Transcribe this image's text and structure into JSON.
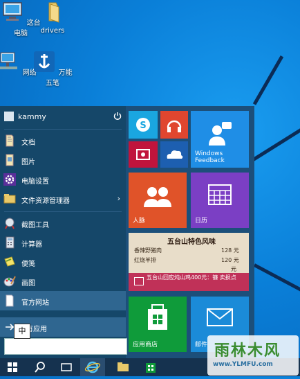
{
  "desktop": {
    "icons": [
      {
        "label": "这台电脑",
        "icon": "computer-icon"
      },
      {
        "label": "drivers",
        "icon": "folder-icon"
      },
      {
        "label": "网络",
        "icon": "network-icon"
      },
      {
        "label": "万能五笔",
        "icon": "ime-app-icon"
      }
    ]
  },
  "start_menu": {
    "user": {
      "name": "kammy"
    },
    "items": [
      {
        "label": "文档",
        "icon": "documents-icon"
      },
      {
        "label": "图片",
        "icon": "pictures-icon"
      },
      {
        "label": "电脑设置",
        "icon": "settings-gear-icon"
      },
      {
        "label": "文件资源管理器",
        "icon": "file-explorer-icon",
        "has_submenu": true
      },
      {
        "label": "截图工具",
        "icon": "snipping-tool-icon"
      },
      {
        "label": "计算器",
        "icon": "calculator-icon"
      },
      {
        "label": "便笺",
        "icon": "sticky-notes-icon"
      },
      {
        "label": "画图",
        "icon": "paint-icon"
      },
      {
        "label": "官方网站",
        "icon": "webpage-icon"
      }
    ],
    "all_apps_label": "有应用",
    "search": {
      "ime_indicator": "中",
      "value": ""
    },
    "tiles": {
      "skype": {
        "label": ""
      },
      "music": {
        "label": ""
      },
      "video": {
        "label": ""
      },
      "onedrive": {
        "label": ""
      },
      "feedback": {
        "label": "Windows Feedback"
      },
      "people": {
        "label": "人脉"
      },
      "calendar": {
        "label": "日历"
      },
      "news": {
        "menu_title": "五台山特色风味",
        "rows": [
          {
            "name": "香辣野猪肉",
            "price": "128 元"
          },
          {
            "name": "红烧羊排",
            "price": "120 元"
          },
          {
            "name": "",
            "price": "元"
          }
        ],
        "caption": "五台山回应炖山鸡400元：镰 卖损点"
      },
      "store": {
        "label": "应用商店"
      },
      "mail": {
        "label": "邮件"
      }
    }
  },
  "taskbar": {
    "items": [
      "start-button",
      "search-button",
      "task-view-button",
      "ie-button",
      "explorer-button",
      "store-button"
    ]
  },
  "watermark": {
    "text": "雨林木风",
    "url": "www.YLMFU.com"
  },
  "colors": {
    "desktop": "#0a7fd8",
    "menu_left": "#154769",
    "menu_right": "#1c4f7a",
    "skype": "#1aa6e0",
    "music": "#e0462f",
    "video": "#c0143c",
    "onedrive": "#1d5fb0",
    "feedback": "#1f8ee6",
    "people": "#e05329",
    "calendar": "#7b3fc4",
    "news": "#c03158",
    "store": "#0f9b3a",
    "mail": "#1b8bd8",
    "taskbar": "#15324f"
  }
}
